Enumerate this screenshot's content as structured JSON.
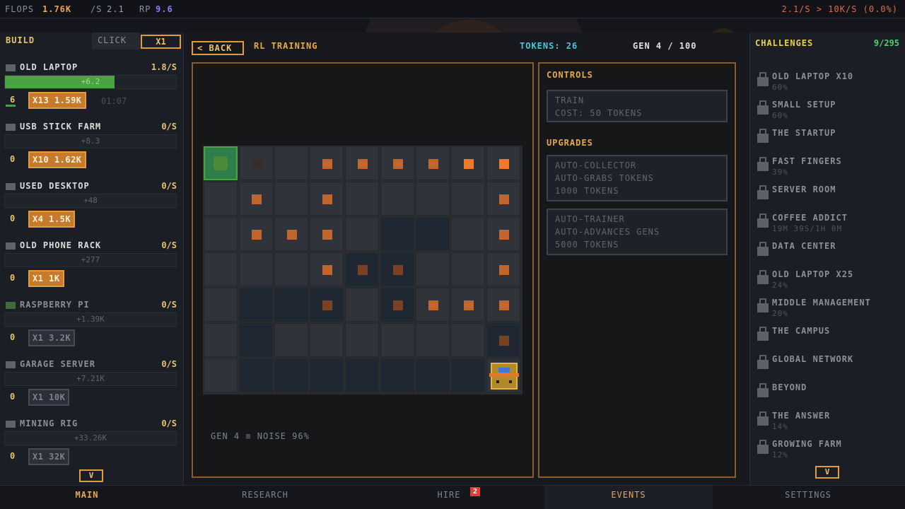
{
  "topbar": {
    "flops_label": "FLOPS",
    "flops_value": "1.76K",
    "per_sec_label": "/S",
    "per_sec_value": "2.1",
    "rp_label": "RP",
    "rp_value": "9.6",
    "goal": "2.1/S > 10K/S (0.0%)"
  },
  "left": {
    "tab_build": "BUILD",
    "tab_click": "CLICK",
    "multiplier": "X1",
    "scroll_label": "V",
    "items": [
      {
        "name": "OLD LAPTOP",
        "rate": "1.8/S",
        "bar": "+6.2",
        "progress": 0.64,
        "count": "6",
        "buy": "X13 1.59K",
        "timer": "01:07",
        "affordable": true,
        "icon": "laptop-icon"
      },
      {
        "name": "USB STICK FARM",
        "rate": "0/S",
        "bar": "+8.3",
        "count": "0",
        "buy": "X10 1.62K",
        "affordable": true,
        "icon": "usb-stick-icon"
      },
      {
        "name": "USED DESKTOP",
        "rate": "0/S",
        "bar": "+48",
        "count": "0",
        "buy": "X4 1.5K",
        "affordable": true,
        "icon": "desktop-icon"
      },
      {
        "name": "OLD PHONE RACK",
        "rate": "0/S",
        "bar": "+277",
        "count": "0",
        "buy": "X1 1K",
        "affordable": true,
        "icon": "phone-rack-icon"
      },
      {
        "name": "RASPBERRY PI",
        "rate": "0/S",
        "bar": "+1.39K",
        "count": "0",
        "buy": "X1 3.2K",
        "affordable": false,
        "icon": "raspberry-pi-icon"
      },
      {
        "name": "GARAGE SERVER",
        "rate": "0/S",
        "bar": "+7.21K",
        "count": "0",
        "buy": "X1 10K",
        "affordable": false,
        "icon": "server-icon"
      },
      {
        "name": "MINING RIG",
        "rate": "0/S",
        "bar": "+33.26K",
        "count": "0",
        "buy": "X1 32K",
        "affordable": false,
        "icon": "mining-rig-icon"
      }
    ]
  },
  "center": {
    "back": "< BACK",
    "title": "RL TRAINING",
    "tokens": "TOKENS: 26",
    "gen": "GEN 4 / 100",
    "grid_footer": "GEN 4  ≡  NOISE 96%",
    "controls_title": "CONTROLS",
    "train_label": "TRAIN",
    "train_cost": "COST: 50 TOKENS",
    "upgrades_title": "UPGRADES",
    "upgrades": [
      {
        "name": "AUTO-COLLECTOR",
        "desc": "AUTO-GRABS TOKENS",
        "cost": "1000 TOKENS"
      },
      {
        "name": "AUTO-TRAINER",
        "desc": "AUTO-ADVANCES GENS",
        "cost": "5000 TOKENS"
      }
    ],
    "grid_cells": [
      [
        "start",
        "f",
        "e",
        "d",
        "d",
        "d",
        "d",
        "b",
        "b"
      ],
      [
        "e",
        "d",
        "e",
        "d",
        "e",
        "e",
        "e",
        "e",
        "d"
      ],
      [
        "e",
        "d",
        "d",
        "d",
        "e",
        "k",
        "k",
        "e",
        "d"
      ],
      [
        "e",
        "e",
        "e",
        "d",
        "m",
        "m",
        "e",
        "e",
        "d"
      ],
      [
        "e",
        "k",
        "k",
        "m",
        "e",
        "m",
        "d",
        "d",
        "d"
      ],
      [
        "e",
        "k",
        "e",
        "e",
        "e",
        "e",
        "e",
        "e",
        "m"
      ],
      [
        "e",
        "k",
        "k",
        "k",
        "k",
        "k",
        "k",
        "k",
        "agent"
      ]
    ]
  },
  "right": {
    "title": "CHALLENGES",
    "count": "9/295",
    "scroll_label": "V",
    "challenges": [
      {
        "name": "OLD LAPTOP X10",
        "sub": "60%"
      },
      {
        "name": "SMALL SETUP",
        "sub": "60%"
      },
      {
        "name": "THE STARTUP",
        "sub": ""
      },
      {
        "name": "FAST FINGERS",
        "sub": "39%"
      },
      {
        "name": "SERVER ROOM",
        "sub": ""
      },
      {
        "name": "COFFEE ADDICT",
        "sub": "19M 39S/1H 0M"
      },
      {
        "name": "DATA CENTER",
        "sub": ""
      },
      {
        "name": "OLD LAPTOP X25",
        "sub": "24%"
      },
      {
        "name": "MIDDLE MANAGEMENT",
        "sub": "20%"
      },
      {
        "name": "THE CAMPUS",
        "sub": ""
      },
      {
        "name": "GLOBAL NETWORK",
        "sub": ""
      },
      {
        "name": "BEYOND",
        "sub": ""
      },
      {
        "name": "THE ANSWER",
        "sub": "14%"
      },
      {
        "name": "GROWING FARM",
        "sub": "12%"
      }
    ]
  },
  "nav": {
    "main": "MAIN",
    "research": "RESEARCH",
    "hire": "HIRE",
    "hire_badge": "2",
    "events": "EVENTS",
    "settings": "SETTINGS"
  }
}
